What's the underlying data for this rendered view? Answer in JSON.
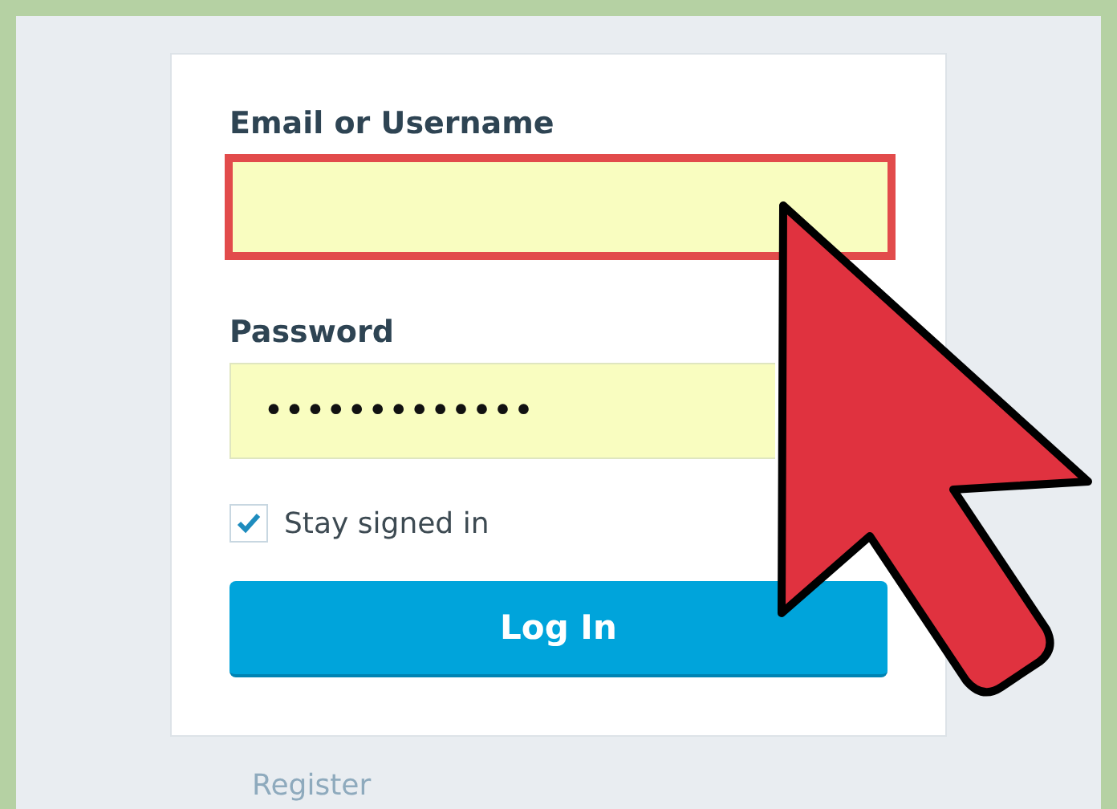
{
  "login_form": {
    "fields": [
      {
        "label": "Email or Username",
        "highlighted": true
      },
      {
        "label": "Password",
        "value": "•••••••••••••",
        "highlighted": false
      }
    ],
    "stay_signed_in": {
      "label": "Stay signed in",
      "checked": true
    },
    "button": "Log In"
  },
  "register_link": "Register"
}
